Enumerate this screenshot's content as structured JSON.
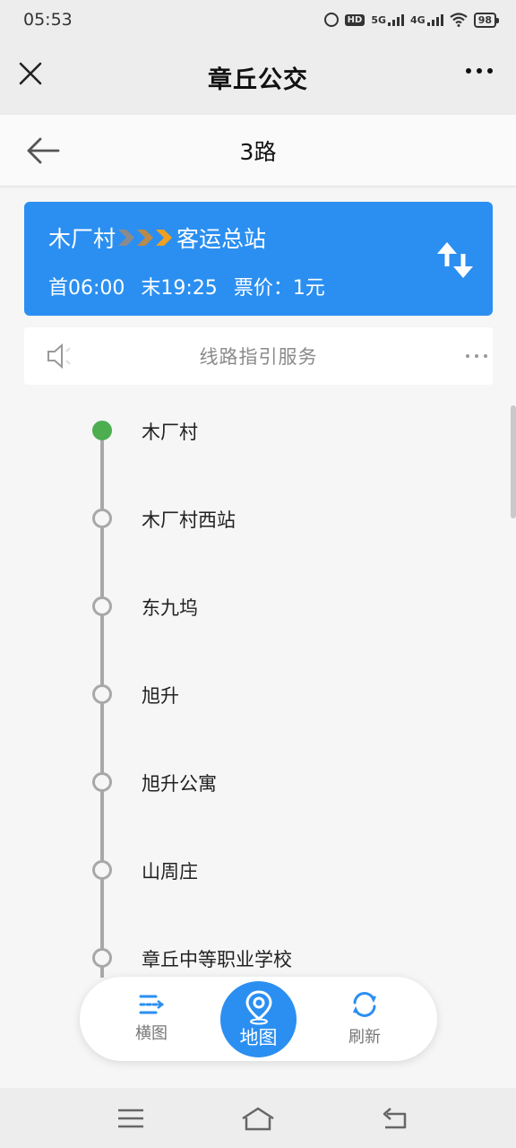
{
  "status_bar": {
    "time": "05:53",
    "hd_label": "HD",
    "net1": "5G",
    "net2": "4G",
    "battery": "98"
  },
  "title_bar": {
    "title": "章丘公交"
  },
  "sub_header": {
    "route_name": "3路"
  },
  "route_card": {
    "from": "木厂村",
    "to": "客运总站",
    "first_bus": "首06:00",
    "last_bus": "末19:25",
    "fare": "票价：1元",
    "accent": "#2b8ff1"
  },
  "guide_bar": {
    "text": "线路指引服务"
  },
  "stops": [
    {
      "name": "木厂村",
      "current": true
    },
    {
      "name": "木厂村西站",
      "current": false
    },
    {
      "name": "东九坞",
      "current": false
    },
    {
      "name": "旭升",
      "current": false
    },
    {
      "name": "旭升公寓",
      "current": false
    },
    {
      "name": "山周庄",
      "current": false
    },
    {
      "name": "章丘中等职业学校",
      "current": false
    }
  ],
  "toolbar": {
    "horizontal_label": "横图",
    "map_label": "地图",
    "refresh_label": "刷新"
  },
  "colors": {
    "current_stop": "#4cae4f",
    "line": "#a8a8a8",
    "chevron_orange": "#f0a020"
  }
}
